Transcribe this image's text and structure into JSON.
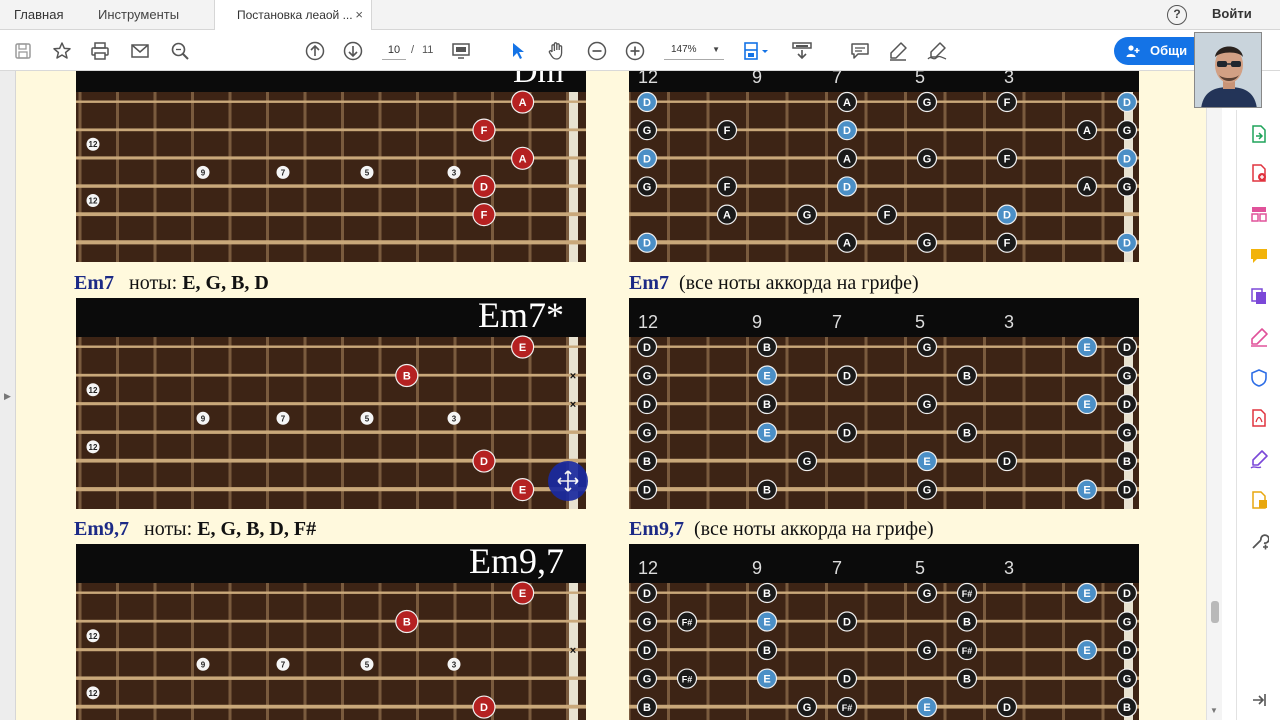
{
  "tabs": {
    "home": "Главная",
    "tools": "Инструменты",
    "document": "Постановка леаой ...",
    "close": "×"
  },
  "header": {
    "help": "?",
    "signin": "Войти"
  },
  "toolbar": {
    "page_current": "10",
    "page_sep": "/",
    "page_total": "11",
    "zoom": "147%",
    "share_label": "Общи"
  },
  "icons": [
    "save-icon",
    "star-icon",
    "print-icon",
    "mail-icon",
    "search-icon",
    "page-up-icon",
    "page-down-icon",
    "fit-page-icon",
    "select-arrow-icon",
    "hand-icon",
    "zoom-out-icon",
    "zoom-in-icon",
    "page-view-icon",
    "scroll-mode-icon",
    "comment-icon",
    "highlight-pen-icon",
    "sign-icon"
  ],
  "right_rail_icons": [
    "export-pdf-icon",
    "create-pdf-icon",
    "organize-pages-icon",
    "comment-tool-icon",
    "combine-files-icon",
    "fill-sign-icon",
    "protect-icon",
    "pdf-icon",
    "sign-tool-icon",
    "edit-pdf-icon",
    "more-tools-icon"
  ],
  "colors": {
    "chord_name": "#1c2a86",
    "red_note": "#b52121",
    "blue_note": "#4b8fc6",
    "black_note": "#1a1a1a",
    "fret_wood": "#3d2415",
    "page_bg": "#fff9dd",
    "share_button": "#1473e6"
  },
  "sections": [
    {
      "chord": "Em7",
      "notes_label": "ноты:",
      "notes": "E, G, B, D",
      "right_chord": "Em7",
      "right_caption": "(все ноты аккорда на грифе)"
    },
    {
      "chord": "Em9,7",
      "notes_label": "ноты:",
      "notes": "E, G, B, D, F#",
      "right_chord": "Em9,7",
      "right_caption": "(все ноты аккорда на грифе)"
    }
  ],
  "diagrams": {
    "dm_title": "Dm",
    "em7_title": "Em7*",
    "em97_title": "Em9,7",
    "fret_numbers": [
      "12",
      "9",
      "7",
      "5",
      "3"
    ],
    "dm_left_notes": [
      {
        "s": 0,
        "f": 11,
        "n": "A"
      },
      {
        "s": 1,
        "f": 10,
        "n": "F"
      },
      {
        "s": 2,
        "f": 11,
        "n": "A"
      },
      {
        "s": 3,
        "f": 10,
        "n": "D"
      },
      {
        "s": 4,
        "f": 10,
        "n": "F"
      }
    ],
    "dm_right_notes": [
      {
        "s": 0,
        "f": 0,
        "n": "D"
      },
      {
        "s": 0,
        "f": 5,
        "n": "A"
      },
      {
        "s": 0,
        "f": 7,
        "n": "G"
      },
      {
        "s": 0,
        "f": 9,
        "n": "F"
      },
      {
        "s": 0,
        "f": 12,
        "n": "D"
      },
      {
        "s": 1,
        "f": 0,
        "n": "G"
      },
      {
        "s": 1,
        "f": 2,
        "n": "F"
      },
      {
        "s": 1,
        "f": 5,
        "n": "D"
      },
      {
        "s": 1,
        "f": 11,
        "n": "A"
      },
      {
        "s": 1,
        "f": 12,
        "n": "G"
      },
      {
        "s": 2,
        "f": 0,
        "n": "D"
      },
      {
        "s": 2,
        "f": 5,
        "n": "A"
      },
      {
        "s": 2,
        "f": 7,
        "n": "G"
      },
      {
        "s": 2,
        "f": 9,
        "n": "F"
      },
      {
        "s": 2,
        "f": 12,
        "n": "D"
      },
      {
        "s": 3,
        "f": 0,
        "n": "G"
      },
      {
        "s": 3,
        "f": 2,
        "n": "F"
      },
      {
        "s": 3,
        "f": 5,
        "n": "D"
      },
      {
        "s": 3,
        "f": 11,
        "n": "A"
      },
      {
        "s": 3,
        "f": 12,
        "n": "G"
      },
      {
        "s": 4,
        "f": 2,
        "n": "A"
      },
      {
        "s": 4,
        "f": 4,
        "n": "G"
      },
      {
        "s": 4,
        "f": 6,
        "n": "F"
      },
      {
        "s": 4,
        "f": 9,
        "n": "D"
      },
      {
        "s": 5,
        "f": 0,
        "n": "D"
      },
      {
        "s": 5,
        "f": 5,
        "n": "A"
      },
      {
        "s": 5,
        "f": 7,
        "n": "G"
      },
      {
        "s": 5,
        "f": 9,
        "n": "F"
      },
      {
        "s": 5,
        "f": 12,
        "n": "D"
      }
    ],
    "em7_left_notes": [
      {
        "s": 0,
        "f": 11,
        "n": "E"
      },
      {
        "s": 1,
        "f": 8,
        "n": "B"
      },
      {
        "s": 4,
        "f": 10,
        "n": "D"
      },
      {
        "s": 5,
        "f": 11,
        "n": "E"
      }
    ],
    "em7_right_notes": [
      {
        "s": 0,
        "f": 0,
        "n": "D"
      },
      {
        "s": 0,
        "f": 3,
        "n": "B"
      },
      {
        "s": 0,
        "f": 7,
        "n": "G"
      },
      {
        "s": 0,
        "f": 11,
        "n": "E"
      },
      {
        "s": 0,
        "f": 12,
        "n": "D"
      },
      {
        "s": 1,
        "f": 0,
        "n": "G"
      },
      {
        "s": 1,
        "f": 3,
        "n": "E"
      },
      {
        "s": 1,
        "f": 5,
        "n": "D"
      },
      {
        "s": 1,
        "f": 8,
        "n": "B"
      },
      {
        "s": 1,
        "f": 12,
        "n": "G"
      },
      {
        "s": 2,
        "f": 0,
        "n": "D"
      },
      {
        "s": 2,
        "f": 3,
        "n": "B"
      },
      {
        "s": 2,
        "f": 7,
        "n": "G"
      },
      {
        "s": 2,
        "f": 11,
        "n": "E"
      },
      {
        "s": 2,
        "f": 12,
        "n": "D"
      },
      {
        "s": 3,
        "f": 0,
        "n": "G"
      },
      {
        "s": 3,
        "f": 3,
        "n": "E"
      },
      {
        "s": 3,
        "f": 5,
        "n": "D"
      },
      {
        "s": 3,
        "f": 8,
        "n": "B"
      },
      {
        "s": 3,
        "f": 12,
        "n": "G"
      },
      {
        "s": 4,
        "f": 0,
        "n": "B"
      },
      {
        "s": 4,
        "f": 4,
        "n": "G"
      },
      {
        "s": 4,
        "f": 7,
        "n": "E"
      },
      {
        "s": 4,
        "f": 9,
        "n": "D"
      },
      {
        "s": 4,
        "f": 12,
        "n": "B"
      },
      {
        "s": 5,
        "f": 0,
        "n": "D"
      },
      {
        "s": 5,
        "f": 3,
        "n": "B"
      },
      {
        "s": 5,
        "f": 7,
        "n": "G"
      },
      {
        "s": 5,
        "f": 11,
        "n": "E"
      },
      {
        "s": 5,
        "f": 12,
        "n": "D"
      }
    ],
    "em97_left_notes": [
      {
        "s": 0,
        "f": 11,
        "n": "E"
      },
      {
        "s": 1,
        "f": 8,
        "n": "B"
      },
      {
        "s": 4,
        "f": 10,
        "n": "D"
      }
    ],
    "em97_right_notes": [
      {
        "s": 0,
        "f": 0,
        "n": "D"
      },
      {
        "s": 0,
        "f": 3,
        "n": "B"
      },
      {
        "s": 0,
        "f": 7,
        "n": "G"
      },
      {
        "s": 0,
        "f": 8,
        "n": "F#"
      },
      {
        "s": 0,
        "f": 11,
        "n": "E"
      },
      {
        "s": 0,
        "f": 12,
        "n": "D"
      },
      {
        "s": 1,
        "f": 0,
        "n": "G"
      },
      {
        "s": 1,
        "f": 1,
        "n": "F#"
      },
      {
        "s": 1,
        "f": 3,
        "n": "E"
      },
      {
        "s": 1,
        "f": 5,
        "n": "D"
      },
      {
        "s": 1,
        "f": 8,
        "n": "B"
      },
      {
        "s": 1,
        "f": 12,
        "n": "G"
      },
      {
        "s": 2,
        "f": 0,
        "n": "D"
      },
      {
        "s": 2,
        "f": 3,
        "n": "B"
      },
      {
        "s": 2,
        "f": 7,
        "n": "G"
      },
      {
        "s": 2,
        "f": 8,
        "n": "F#"
      },
      {
        "s": 2,
        "f": 11,
        "n": "E"
      },
      {
        "s": 2,
        "f": 12,
        "n": "D"
      },
      {
        "s": 3,
        "f": 0,
        "n": "G"
      },
      {
        "s": 3,
        "f": 1,
        "n": "F#"
      },
      {
        "s": 3,
        "f": 3,
        "n": "E"
      },
      {
        "s": 3,
        "f": 5,
        "n": "D"
      },
      {
        "s": 3,
        "f": 8,
        "n": "B"
      },
      {
        "s": 3,
        "f": 12,
        "n": "G"
      },
      {
        "s": 4,
        "f": 0,
        "n": "B"
      },
      {
        "s": 4,
        "f": 4,
        "n": "G"
      },
      {
        "s": 4,
        "f": 5,
        "n": "F#"
      },
      {
        "s": 4,
        "f": 7,
        "n": "E"
      },
      {
        "s": 4,
        "f": 9,
        "n": "D"
      },
      {
        "s": 4,
        "f": 12,
        "n": "B"
      }
    ]
  }
}
